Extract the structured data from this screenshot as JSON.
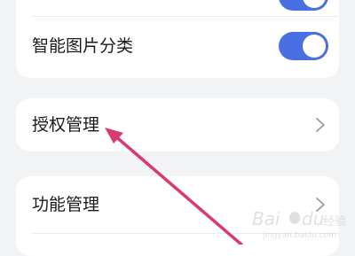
{
  "settings": {
    "items": [
      {
        "label": "",
        "type": "toggle",
        "on": true
      },
      {
        "label": "智能图片分类",
        "type": "toggle",
        "on": true
      },
      {
        "label": "授权管理",
        "type": "link"
      },
      {
        "label": "功能管理",
        "type": "link"
      }
    ]
  },
  "colors": {
    "background": "#f1f3f5",
    "card": "#ffffff",
    "toggle_on": "#4a6fe0",
    "annotation_arrow": "#d93a72"
  },
  "watermark": {
    "text": "Bai du 经验",
    "url": "jingyan.baidu.com"
  }
}
